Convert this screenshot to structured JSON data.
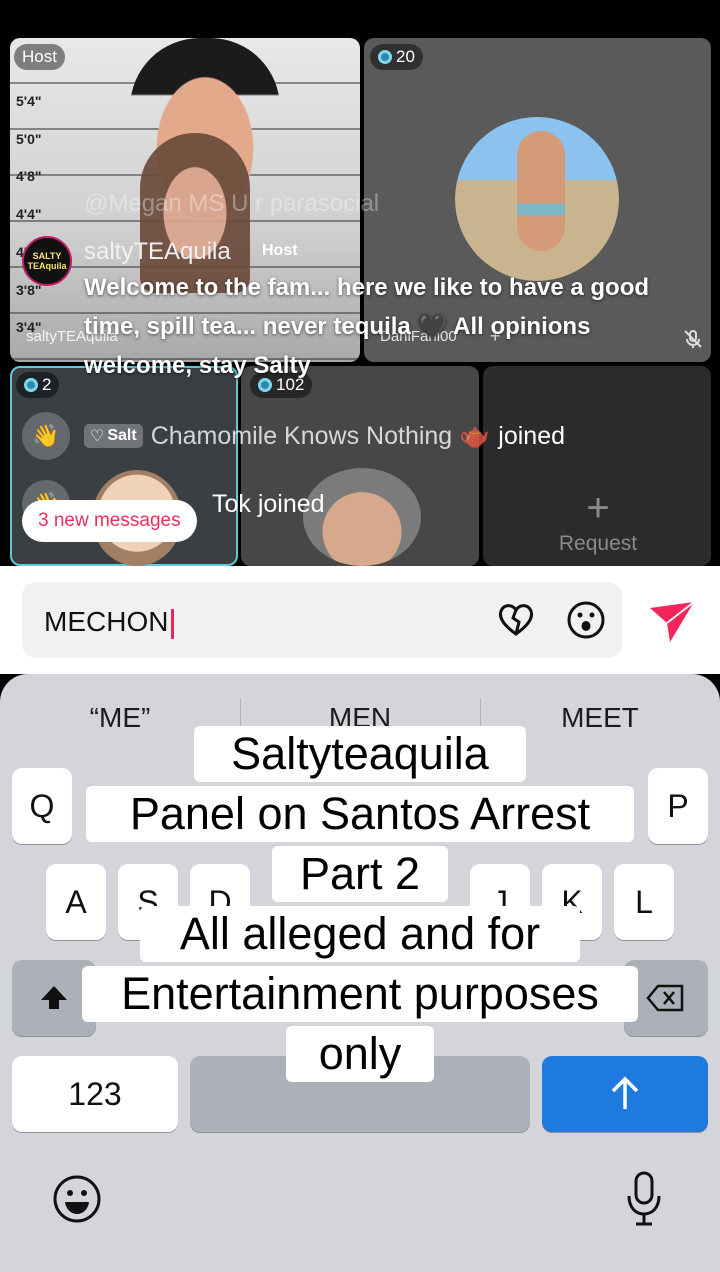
{
  "live": {
    "host_badge": "Host",
    "guest_viewers": "20",
    "small1_viewers": "2",
    "small2_viewers": "102",
    "host_tile_name": "saltyTEAquila",
    "guest_tile_name": "DaniFani00",
    "guest_tile_add": "+",
    "request_plus": "+",
    "request_label": "Request",
    "mug_heights": [
      "5'4\"",
      "5'0\"",
      "4'8\"",
      "4'4\"",
      "4'",
      "3'8\"",
      "3'4\""
    ]
  },
  "chat": {
    "ghost_line": "@Megan MS U r parasocial",
    "avatar_text": "SALTY TEAquila",
    "username": "saltyTEAquila",
    "host_tag": "Host",
    "message": "Welcome to the fam... here we like to have a good time, spill tea... never tequila 🖤 All opinions welcome, stay Salty",
    "join_badge": "Salt",
    "join_name": "Chamomile Knows Nothing 🫖",
    "join_verb": "joined",
    "join2_text": "Tok joined",
    "new_messages": "3 new messages"
  },
  "input": {
    "value": "MECHON",
    "colors": {
      "caret": "#f2245a",
      "send": "#f2245a"
    }
  },
  "keyboard": {
    "suggestions": [
      "“ME”",
      "MEN",
      "MEET"
    ],
    "row1": [
      "Q",
      "P"
    ],
    "row2": [
      "A",
      "S",
      "D",
      "J",
      "K",
      "L"
    ],
    "numbers_key": "123",
    "return_icon": "arrow-up-icon",
    "colors": {
      "return": "#1f7ae0"
    }
  },
  "caption": {
    "lines": [
      "Saltyteaquila",
      "Panel on Santos Arrest",
      "Part 2",
      "All alleged and for",
      "Entertainment purposes",
      "only"
    ]
  }
}
